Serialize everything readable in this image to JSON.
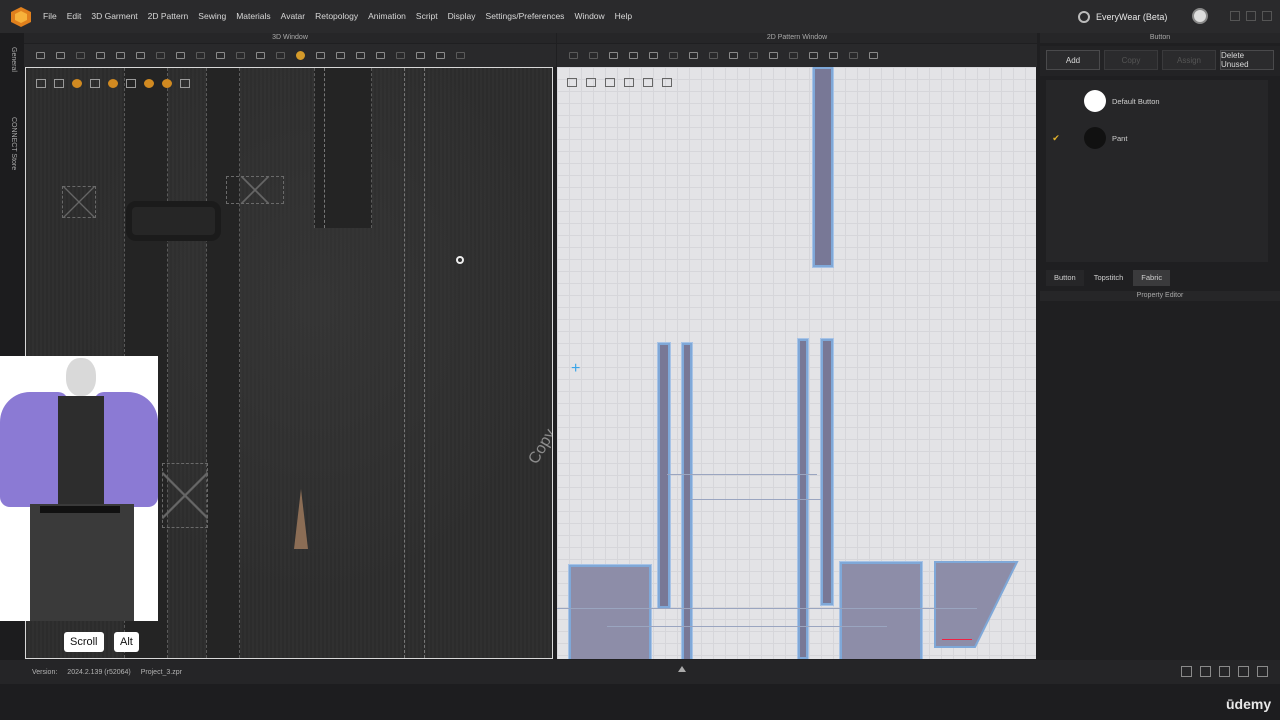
{
  "menu": {
    "items": [
      "File",
      "Edit",
      "3D Garment",
      "2D Pattern",
      "Sewing",
      "Materials",
      "Avatar",
      "Retopology",
      "Animation",
      "Script",
      "Display",
      "Settings/Preferences",
      "Window",
      "Help"
    ],
    "brand": "EveryWear (Beta)"
  },
  "side_tabs": {
    "general": "General",
    "connect": "CONNECT Store"
  },
  "windows": {
    "three_d": {
      "title": "3D Window"
    },
    "two_d": {
      "title": "2D Pattern Window"
    },
    "button": {
      "title": "Button"
    },
    "property": {
      "title": "Property Editor"
    }
  },
  "viewport3d": {
    "watermark": "Copy"
  },
  "keys": {
    "scroll": "Scroll",
    "alt": "Alt"
  },
  "button_panel": {
    "actions": {
      "add": "Add",
      "copy": "Copy",
      "assign": "Assign",
      "delete_unused": "Delete Unused"
    },
    "items": [
      {
        "label": "Default Button",
        "checked": false,
        "color": "#ffffff"
      },
      {
        "label": "Pant",
        "checked": true,
        "color": "#111111"
      }
    ],
    "check_mark": "✔",
    "tabs": [
      "Button",
      "Topstitch",
      "Fabric"
    ]
  },
  "status": {
    "version_label": "Version:",
    "version": "2024.2.139 (r52064)",
    "project": "Project_3.zpr"
  },
  "footer": {
    "logo": "ūdemy"
  },
  "colors": {
    "accent": "#d49a2a",
    "pattern_fill": "#8d8da8",
    "pattern_outline": "#7fa8d8",
    "avatar_jacket": "#8b7ad4"
  }
}
